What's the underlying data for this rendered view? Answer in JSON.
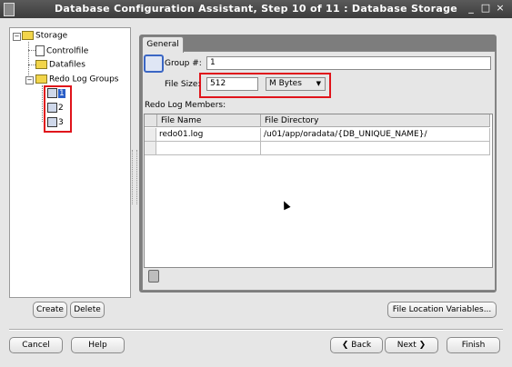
{
  "window": {
    "title": "Database Configuration Assistant, Step 10 of 11 : Database Storage",
    "minimize": "_",
    "maximize": "□",
    "close": "×"
  },
  "tree": {
    "root": "Storage",
    "items": [
      {
        "label": "Controlfile"
      },
      {
        "label": "Datafiles"
      },
      {
        "label": "Redo Log Groups",
        "children": [
          {
            "label": "1"
          },
          {
            "label": "2"
          },
          {
            "label": "3"
          }
        ]
      }
    ]
  },
  "tabs": [
    {
      "label": "General"
    }
  ],
  "form": {
    "group_label": "Group #:",
    "group_value": "1",
    "file_size_label": "File Size:",
    "file_size_value": "512",
    "unit_selected": "M Bytes",
    "members_label": "Redo Log Members:"
  },
  "members_table": {
    "columns": [
      "File Name",
      "File Directory"
    ],
    "rows": [
      [
        "redo01.log",
        "/u01/app/oradata/{DB_UNIQUE_NAME}/"
      ],
      [
        "",
        ""
      ]
    ]
  },
  "buttons": {
    "create": "Create",
    "delete": "Delete",
    "file_location_variables": "File Location Variables...",
    "cancel": "Cancel",
    "help": "Help",
    "back": "Back",
    "next": "Next",
    "finish": "Finish"
  }
}
